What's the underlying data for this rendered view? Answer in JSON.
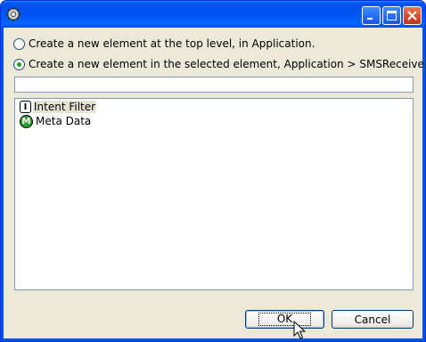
{
  "window": {
    "title": "",
    "icon": "gear-icon",
    "buttons": [
      "minimize",
      "maximize",
      "close"
    ]
  },
  "options": {
    "top_level": {
      "label": "Create a new element at the top level, in Application.",
      "selected": false
    },
    "in_selected": {
      "label": "Create a new element in the selected element, Application > SMSReceiver.",
      "selected": true
    }
  },
  "filter": {
    "value": "",
    "placeholder": ""
  },
  "elements": [
    {
      "icon": "intent-filter-icon",
      "icon_letter": "I",
      "label": "Intent Filter",
      "selected": true
    },
    {
      "icon": "meta-data-icon",
      "icon_letter": "M",
      "label": "Meta Data",
      "selected": false
    }
  ],
  "footer": {
    "ok_label": "OK",
    "cancel_label": "Cancel"
  },
  "colors": {
    "titlebar": "#0055e5",
    "dialog_bg": "#ece9d8",
    "radio_dot": "#21a121",
    "meta_icon": "#2e9c2e"
  }
}
